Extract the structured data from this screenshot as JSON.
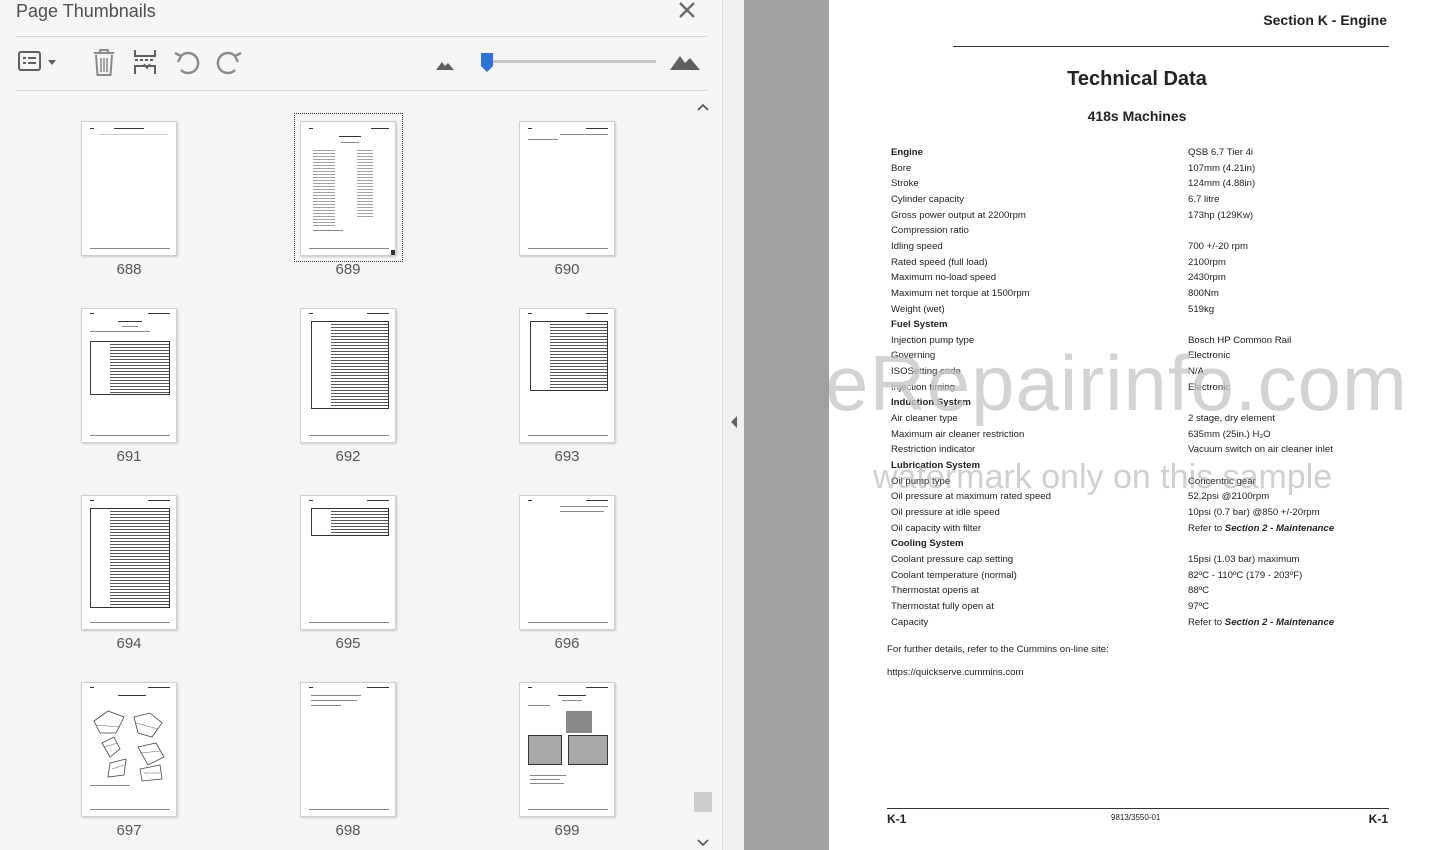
{
  "panel": {
    "title": "Page Thumbnails",
    "icons": {
      "close": "close-icon",
      "options": "list-options-icon",
      "delete": "trash-icon",
      "insert": "insert-pages-icon",
      "rotate_left": "rotate-counterclockwise-icon",
      "rotate_right": "rotate-clockwise-icon",
      "zoom_out": "mountain-small-icon",
      "zoom_in": "mountain-large-icon"
    },
    "zoom_slider_fraction": 0.03,
    "selected_page": "689",
    "thumbnails": [
      {
        "num": "688"
      },
      {
        "num": "689"
      },
      {
        "num": "690"
      },
      {
        "num": "691"
      },
      {
        "num": "692"
      },
      {
        "num": "693"
      },
      {
        "num": "694"
      },
      {
        "num": "695"
      },
      {
        "num": "696"
      },
      {
        "num": "697"
      },
      {
        "num": "698"
      },
      {
        "num": "699"
      }
    ]
  },
  "document": {
    "header": "Section K - Engine",
    "title": "Technical Data",
    "subtitle": "418s Machines",
    "specs": [
      {
        "label": "Engine",
        "value": "QSB 6.7 Tier 4i",
        "header": true
      },
      {
        "label": "Bore",
        "value": "107mm (4.21in)"
      },
      {
        "label": "Stroke",
        "value": "124mm (4.88in)"
      },
      {
        "label": "Cylinder capacity",
        "value": "6.7 litre"
      },
      {
        "label": "Gross power output at 2200rpm",
        "value": "173hp (129Kw)"
      },
      {
        "label": "Compression ratio",
        "value": ""
      },
      {
        "label": "Idling speed",
        "value": "700 +/-20 rpm"
      },
      {
        "label": "Rated speed (full load)",
        "value": "2100rpm"
      },
      {
        "label": "Maximum no-load speed",
        "value": "2430rpm"
      },
      {
        "label": "Maximum net torque at 1500rpm",
        "value": "800Nm"
      },
      {
        "label": "Weight (wet)",
        "value": "519kg"
      },
      {
        "label": "Fuel System",
        "value": "",
        "header": true
      },
      {
        "label": "Injection pump type",
        "value": "Bosch HP Common Rail"
      },
      {
        "label": "Governing",
        "value": "Electronic"
      },
      {
        "label": "ISOSetting code",
        "value": "N/A"
      },
      {
        "label": "Injection timing",
        "value": "Electronic"
      },
      {
        "label": "Induction System",
        "value": "",
        "header": true
      },
      {
        "label": "Air cleaner type",
        "value": "2 stage, dry element"
      },
      {
        "label": "Maximum air cleaner restriction",
        "value": "635mm (25in.) H₂O"
      },
      {
        "label": "Restriction indicator",
        "value": "Vacuum switch on air cleaner inlet"
      },
      {
        "label": "Lubrication System",
        "value": "",
        "header": true
      },
      {
        "label": "Oil pump type",
        "value": "Concentric gear"
      },
      {
        "label": "Oil pressure at maximum rated speed",
        "value": "52.2psi @2100rpm"
      },
      {
        "label": "Oil pressure at idle speed",
        "value": "10psi (0.7 bar) @850 +/-20rpm"
      },
      {
        "label": "Oil capacity with filter",
        "value": "Refer to ",
        "value_emph": "Section 2 - Maintenance"
      },
      {
        "label": "Cooling System",
        "value": "",
        "header": true
      },
      {
        "label": "Coolant pressure cap setting",
        "value": "15psi (1.03 bar) maximum"
      },
      {
        "label": "Coolant temperature (normal)",
        "value": "82ºC - 110ºC (179 - 203ºF)"
      },
      {
        "label": "Thermostat opens at",
        "value": "88ºC"
      },
      {
        "label": "Thermostat fully open at",
        "value": "97ºC"
      },
      {
        "label": "Capacity",
        "value": "Refer to ",
        "value_emph": "Section 2 - Maintenance"
      }
    ],
    "further_details": "For further details, refer to the Cummins on-line site:",
    "url": "https://quickserve.cummins.com",
    "footer_left": "K-1",
    "footer_mid": "9813/3550-01",
    "footer_right": "K-1"
  },
  "watermark": {
    "line1": "eRepairinfo.com",
    "line2": "watermark only on this sample"
  }
}
